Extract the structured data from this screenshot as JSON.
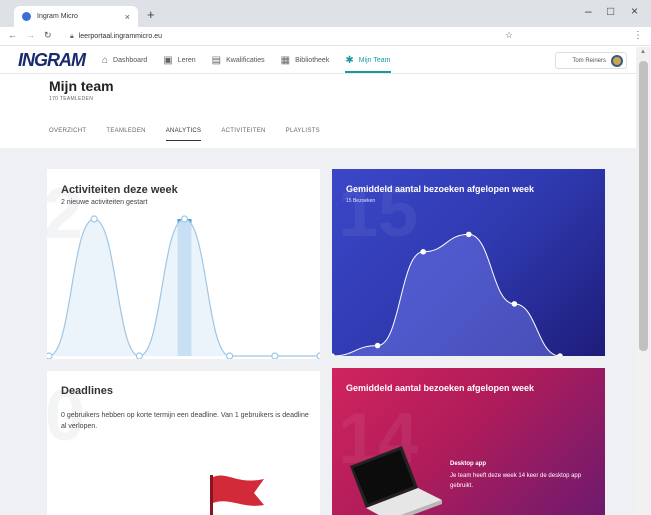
{
  "browser": {
    "tab_title": "Ingram Micro",
    "tab_close": "×",
    "new_tab": "+",
    "url": "leerportaal.ingrammicro.eu",
    "window_controls": [
      "–",
      "□",
      "×"
    ],
    "nav_icons": [
      "back-icon",
      "forward-icon",
      "reload-icon",
      "lock-icon",
      "star-icon",
      "kebab-menu-icon"
    ]
  },
  "app": {
    "logo": "INGRAM",
    "nav": [
      {
        "label": "Dashboard",
        "icon": "home-icon"
      },
      {
        "label": "Leren",
        "icon": "learn-icon"
      },
      {
        "label": "Kwalificaties",
        "icon": "certificate-icon"
      },
      {
        "label": "Bibliotheek",
        "icon": "library-icon"
      },
      {
        "label": "Mijn Team",
        "icon": "team-icon",
        "active": true
      }
    ],
    "user_name": "Tom Reiners"
  },
  "team": {
    "title": "Mijn team",
    "subtitle": "170 TEAMLEDEN",
    "tabs": [
      {
        "label": "OVERZICHT"
      },
      {
        "label": "TEAMLEDEN"
      },
      {
        "label": "ANALYTICS",
        "active": true
      },
      {
        "label": "ACTIVITEITEN"
      },
      {
        "label": "PLAYLISTS"
      }
    ]
  },
  "cards": {
    "activities": {
      "big_number": "2",
      "title": "Activiteiten deze week",
      "subtitle": "2 nieuwe activiteiten gestart"
    },
    "visits": {
      "big_number": "15",
      "title": "Gemiddeld aantal bezoeken afgelopen week",
      "subtitle": "15 Bezoeken"
    },
    "deadlines": {
      "big_number": "0",
      "title": "Deadlines",
      "body": "0 gebruikers hebben op korte termijn een deadline. Van 1 gebruikers is deadline al verlopen."
    },
    "app_visits": {
      "big_number": "14",
      "title": "Gemiddeld aantal bezoeken afgelopen week",
      "app_title": "Desktop app",
      "app_desc": "Je team heeft deze week 14 keer de desktop app gebruikt."
    }
  },
  "colors": {
    "accent": "#1a9aa0",
    "logo": "#1b2a6b",
    "activities_line": "#9fc6e4",
    "activities_bar": "#4a9cd6",
    "visits_gradient": [
      "#3b47c8",
      "#1e1c7a"
    ],
    "app_gradient": [
      "#d0245e",
      "#6e1a6e"
    ],
    "flag": "#d32a3a"
  },
  "chart_data": [
    {
      "type": "area",
      "values": [
        0,
        2,
        0,
        2,
        0,
        0,
        0
      ],
      "ylim": [
        0,
        2
      ],
      "highlight_index": 3
    },
    {
      "type": "area",
      "values": [
        0,
        0.3,
        3,
        3.5,
        1.5,
        0
      ],
      "ylim": [
        0,
        4
      ]
    }
  ]
}
